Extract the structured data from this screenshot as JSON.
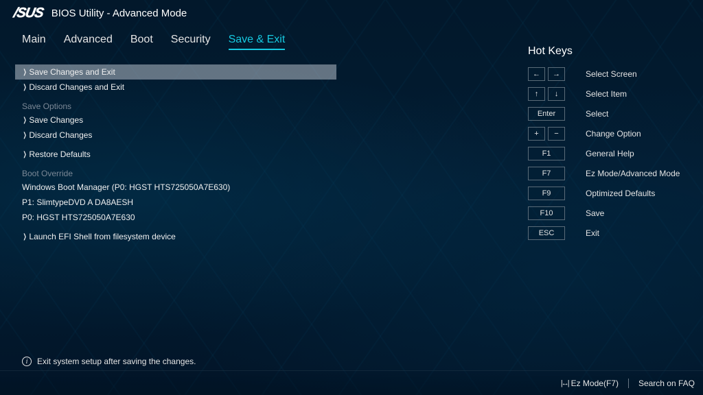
{
  "header": {
    "logo": "/SUS",
    "title": "BIOS Utility - Advanced Mode"
  },
  "tabs": [
    {
      "label": "Main",
      "active": false
    },
    {
      "label": "Advanced",
      "active": false
    },
    {
      "label": "Boot",
      "active": false
    },
    {
      "label": "Security",
      "active": false
    },
    {
      "label": "Save & Exit",
      "active": true
    }
  ],
  "menu": {
    "items": [
      {
        "type": "arrow",
        "label": "Save Changes and Exit",
        "selected": true
      },
      {
        "type": "arrow",
        "label": "Discard Changes and Exit"
      },
      {
        "type": "header",
        "label": "Save Options"
      },
      {
        "type": "arrow",
        "label": "Save Changes"
      },
      {
        "type": "arrow",
        "label": "Discard Changes"
      },
      {
        "type": "spacer"
      },
      {
        "type": "arrow",
        "label": "Restore Defaults"
      },
      {
        "type": "header",
        "label": "Boot Override"
      },
      {
        "type": "plain",
        "label": "Windows Boot Manager (P0: HGST HTS725050A7E630)"
      },
      {
        "type": "plain",
        "label": "P1: SlimtypeDVD A  DA8AESH"
      },
      {
        "type": "plain",
        "label": "P0: HGST HTS725050A7E630"
      },
      {
        "type": "spacer"
      },
      {
        "type": "arrow",
        "label": "Launch EFI Shell from filesystem device"
      }
    ]
  },
  "info_text": "Exit system setup after saving the changes.",
  "hotkeys": {
    "title": "Hot Keys",
    "rows": [
      {
        "keys": [
          "←",
          "→"
        ],
        "label": "Select Screen",
        "mode": "pair"
      },
      {
        "keys": [
          "↑",
          "↓"
        ],
        "label": "Select Item",
        "mode": "pair"
      },
      {
        "keys": [
          "Enter"
        ],
        "label": "Select",
        "mode": "wide"
      },
      {
        "keys": [
          "+",
          "−"
        ],
        "label": "Change Option",
        "mode": "pair"
      },
      {
        "keys": [
          "F1"
        ],
        "label": "General Help",
        "mode": "wide"
      },
      {
        "keys": [
          "F7"
        ],
        "label": "Ez Mode/Advanced Mode",
        "mode": "wide"
      },
      {
        "keys": [
          "F9"
        ],
        "label": "Optimized Defaults",
        "mode": "wide"
      },
      {
        "keys": [
          "F10"
        ],
        "label": "Save",
        "mode": "wide"
      },
      {
        "keys": [
          "ESC"
        ],
        "label": "Exit",
        "mode": "wide"
      }
    ]
  },
  "footer": {
    "ez_mode": "Ez Mode(F7)",
    "search": "Search on FAQ"
  }
}
